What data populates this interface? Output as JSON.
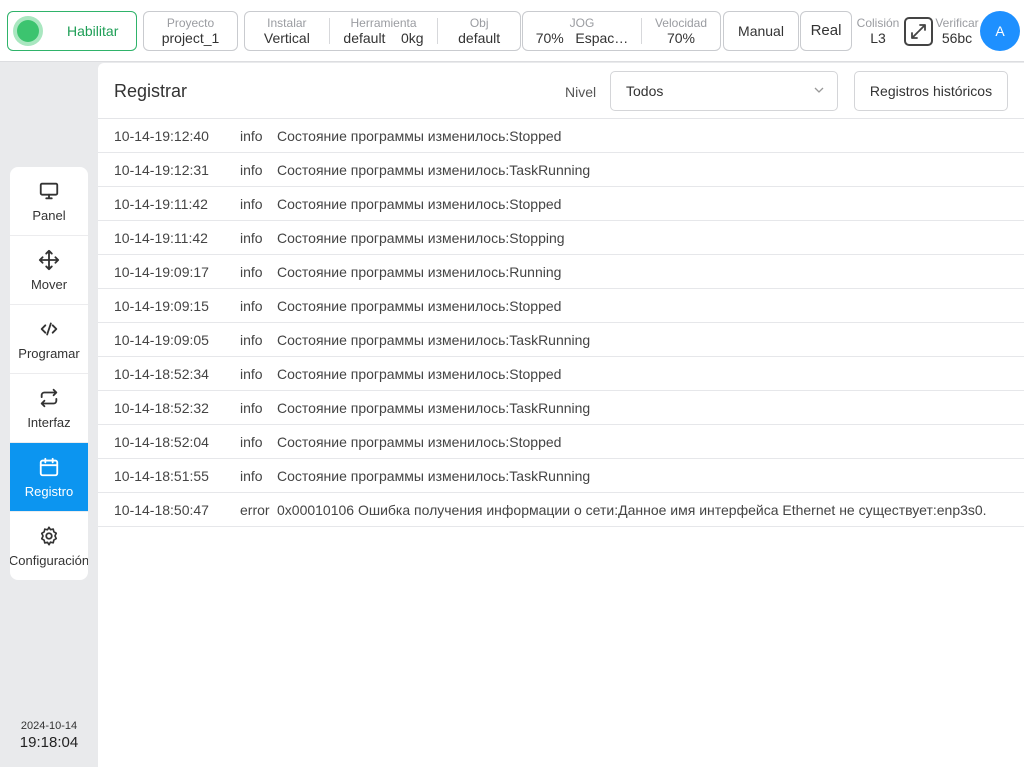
{
  "topbar": {
    "enable_label": "Habilitar",
    "project": {
      "caption": "Proyecto",
      "value": "project_1"
    },
    "install": {
      "caption": "Instalar",
      "value": "Vertical"
    },
    "tool": {
      "caption": "Herramienta",
      "value": "default",
      "weight": "0kg"
    },
    "obj": {
      "caption": "Obj",
      "value": "default"
    },
    "jog": {
      "caption": "JOG",
      "value": "70%",
      "space": "Espac…"
    },
    "speed": {
      "caption": "Velocidad",
      "value": "70%"
    },
    "mode_label": "Manual",
    "real_label": "Real",
    "collision": {
      "caption": "Colisión",
      "value": "L3"
    },
    "verify": {
      "caption": "Verificar",
      "value": "56bc"
    },
    "avatar_letter": "A",
    "enable_color": "#3cc46f",
    "avatar_color": "#1e90ff"
  },
  "sidebar": {
    "items": [
      {
        "label": "Panel",
        "icon": "monitor-icon",
        "active": false
      },
      {
        "label": "Mover",
        "icon": "move-arrows-icon",
        "active": false
      },
      {
        "label": "Programar",
        "icon": "code-icon",
        "active": false
      },
      {
        "label": "Interfaz",
        "icon": "swap-arrows-icon",
        "active": false
      },
      {
        "label": "Registro",
        "icon": "calendar-icon",
        "active": true
      },
      {
        "label": "Configuración",
        "icon": "gear-icon",
        "active": false
      }
    ],
    "active_color": "#0c95f0"
  },
  "clock": {
    "date": "2024-10-14",
    "time": "19:18:04"
  },
  "main": {
    "title": "Registrar",
    "level_label": "Nivel",
    "level_value": "Todos",
    "history_button": "Registros históricos",
    "logs": [
      {
        "time": "10-14-19:12:40",
        "level": "info",
        "message": "Состояние программы изменилось:Stopped"
      },
      {
        "time": "10-14-19:12:31",
        "level": "info",
        "message": "Состояние программы изменилось:TaskRunning"
      },
      {
        "time": "10-14-19:11:42",
        "level": "info",
        "message": "Состояние программы изменилось:Stopped"
      },
      {
        "time": "10-14-19:11:42",
        "level": "info",
        "message": "Состояние программы изменилось:Stopping"
      },
      {
        "time": "10-14-19:09:17",
        "level": "info",
        "message": "Состояние программы изменилось:Running"
      },
      {
        "time": "10-14-19:09:15",
        "level": "info",
        "message": "Состояние программы изменилось:Stopped"
      },
      {
        "time": "10-14-19:09:05",
        "level": "info",
        "message": "Состояние программы изменилось:TaskRunning"
      },
      {
        "time": "10-14-18:52:34",
        "level": "info",
        "message": "Состояние программы изменилось:Stopped"
      },
      {
        "time": "10-14-18:52:32",
        "level": "info",
        "message": "Состояние программы изменилось:TaskRunning"
      },
      {
        "time": "10-14-18:52:04",
        "level": "info",
        "message": "Состояние программы изменилось:Stopped"
      },
      {
        "time": "10-14-18:51:55",
        "level": "info",
        "message": "Состояние программы изменилось:TaskRunning"
      },
      {
        "time": "10-14-18:50:47",
        "level": "error",
        "message": "0x00010106 Ошибка получения информации о сети:Данное имя интерфейса Ethernet не существует:enp3s0."
      }
    ]
  }
}
